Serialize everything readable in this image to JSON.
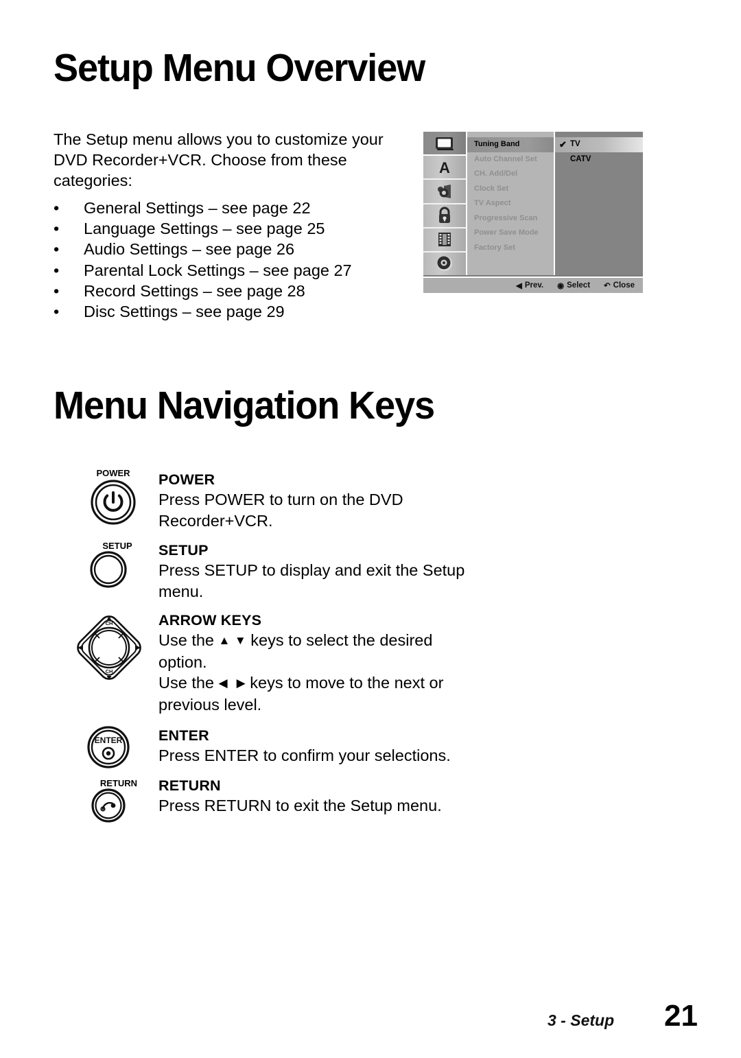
{
  "page": {
    "title": "Setup Menu Overview",
    "section_heading_2": "Menu Navigation Keys",
    "footer_section": "3 - Setup",
    "footer_page_number": "21"
  },
  "intro": {
    "paragraph": "The Setup menu allows you to customize your DVD Recorder+VCR. Choose from these categories:",
    "bullet": "•",
    "categories": [
      "General Settings – see page 22",
      "Language Settings – see page 25",
      "Audio Settings – see page 26",
      "Parental Lock Settings – see page 27",
      "Record Settings – see page 28",
      "Disc Settings – see page 29"
    ]
  },
  "osd": {
    "icons": [
      {
        "name": "tv-monitor-icon",
        "active": true
      },
      {
        "name": "language-letter-a-icon",
        "active": false
      },
      {
        "name": "speaker-audio-icon",
        "active": false
      },
      {
        "name": "padlock-parental-icon",
        "active": false
      },
      {
        "name": "film-strip-record-icon",
        "active": false
      },
      {
        "name": "disc-icon",
        "active": false
      }
    ],
    "menu_items": [
      {
        "label": "Tuning Band",
        "selected": true
      },
      {
        "label": "Auto Channel Set",
        "selected": false
      },
      {
        "label": "CH. Add/Del",
        "selected": false
      },
      {
        "label": "Clock Set",
        "selected": false
      },
      {
        "label": "TV Aspect",
        "selected": false
      },
      {
        "label": "Progressive Scan",
        "selected": false
      },
      {
        "label": "Power Save Mode",
        "selected": false
      },
      {
        "label": "Factory Set",
        "selected": false
      }
    ],
    "options": [
      {
        "label": "TV",
        "checked": true
      },
      {
        "label": "CATV",
        "checked": false
      }
    ],
    "check_glyph": "✔",
    "footer_hints": [
      {
        "glyph": "◀",
        "label": "Prev."
      },
      {
        "glyph": "◉",
        "label": "Select"
      },
      {
        "glyph": "↶",
        "label": "Close"
      }
    ],
    "colors": {
      "background": "#7c7c7c",
      "menu_panel": "#b5b5b5",
      "options_panel": "#848484",
      "hint_bar": "#adadad",
      "highlight": "#9a9a9a"
    }
  },
  "keys": [
    {
      "id": "power",
      "button_label": "POWER",
      "title": "POWER",
      "description": "Press POWER to turn on the DVD Recorder+VCR."
    },
    {
      "id": "setup",
      "button_label": "SETUP",
      "title": "SETUP",
      "description": "Press SETUP to display and exit the Setup menu."
    },
    {
      "id": "arrow",
      "button_label": "CH",
      "title": "ARROW KEYS",
      "description_line1_pre": "Use the ",
      "description_line1_up": "▲",
      "description_line1_down": "▼",
      "description_line1_post": " keys to select the desired option.",
      "description_line2_pre": "Use the ",
      "description_line2_left": "◀",
      "description_line2_right": "▶",
      "description_line2_post": " keys to move to the next or previous level."
    },
    {
      "id": "enter",
      "button_label": "ENTER",
      "title": "ENTER",
      "description": "Press ENTER to confirm your selections."
    },
    {
      "id": "return",
      "button_label": "RETURN",
      "title": "RETURN",
      "description": "Press RETURN to exit the Setup menu."
    }
  ]
}
